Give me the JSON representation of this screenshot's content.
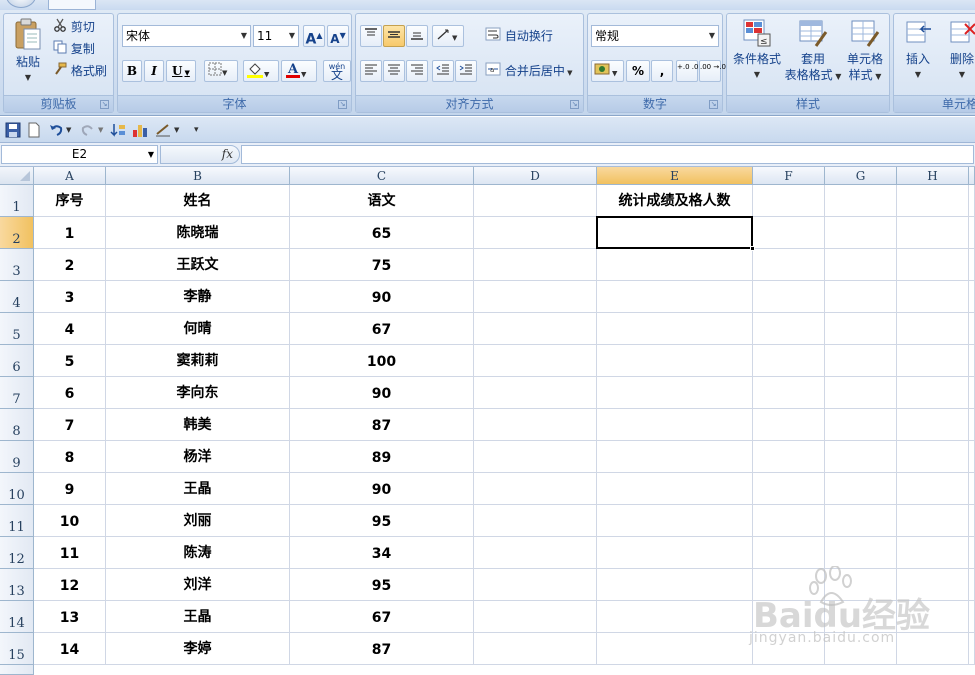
{
  "ribbon": {
    "clipboard": {
      "label": "剪贴板",
      "paste": "粘贴",
      "cut": "剪切",
      "copy": "复制",
      "format_painter": "格式刷"
    },
    "font": {
      "label": "字体",
      "font_name": "宋体",
      "font_size": "11",
      "bold": "B",
      "italic": "I",
      "underline": "U",
      "grow": "A",
      "shrink": "A",
      "phonetic_top": "wén",
      "phonetic_char": "文"
    },
    "alignment": {
      "label": "对齐方式",
      "wrap_text": "自动换行",
      "merge_center": "合并后居中"
    },
    "number": {
      "label": "数字",
      "format": "常规",
      "percent": "%",
      "comma": ",",
      "inc_decimal": "+.0 .00",
      "dec_decimal": ".00 →.0"
    },
    "styles": {
      "label": "样式",
      "conditional": "条件格式",
      "table_line1": "套用",
      "table_line2": "表格格式",
      "cell_line1": "单元格",
      "cell_line2": "样式"
    },
    "cells": {
      "label": "单元格",
      "insert": "插入",
      "delete": "删除"
    }
  },
  "formula_bar": {
    "name_box": "E2",
    "fx": "fx",
    "formula": ""
  },
  "grid": {
    "columns": [
      "A",
      "B",
      "C",
      "D",
      "E",
      "F",
      "G",
      "H"
    ],
    "selected_column": "E",
    "selected_row": "2",
    "header_row": {
      "number": "1",
      "A": "序号",
      "B": "姓名",
      "C": "语文",
      "D": "",
      "E": "统计成绩及格人数"
    },
    "rows": [
      {
        "number": "2",
        "A": "1",
        "B": "陈晓瑞",
        "C": "65"
      },
      {
        "number": "3",
        "A": "2",
        "B": "王跃文",
        "C": "75"
      },
      {
        "number": "4",
        "A": "3",
        "B": "李静",
        "C": "90"
      },
      {
        "number": "5",
        "A": "4",
        "B": "何晴",
        "C": "67"
      },
      {
        "number": "6",
        "A": "5",
        "B": "窦莉莉",
        "C": "100"
      },
      {
        "number": "7",
        "A": "6",
        "B": "李向东",
        "C": "90"
      },
      {
        "number": "8",
        "A": "7",
        "B": "韩美",
        "C": "87"
      },
      {
        "number": "9",
        "A": "8",
        "B": "杨洋",
        "C": "89"
      },
      {
        "number": "10",
        "A": "9",
        "B": "王晶",
        "C": "90"
      },
      {
        "number": "11",
        "A": "10",
        "B": "刘丽",
        "C": "95"
      },
      {
        "number": "12",
        "A": "11",
        "B": "陈涛",
        "C": "34"
      },
      {
        "number": "13",
        "A": "12",
        "B": "刘洋",
        "C": "95"
      },
      {
        "number": "14",
        "A": "13",
        "B": "王晶",
        "C": "67"
      },
      {
        "number": "15",
        "A": "14",
        "B": "李婷",
        "C": "87"
      }
    ]
  },
  "watermark": {
    "brand": "Baidu经验",
    "url": "jingyan.baidu.com"
  },
  "colors": {
    "ribbon_text": "#15428b",
    "selection_header": "#f1c15f",
    "gridline": "#d0d7e5"
  }
}
